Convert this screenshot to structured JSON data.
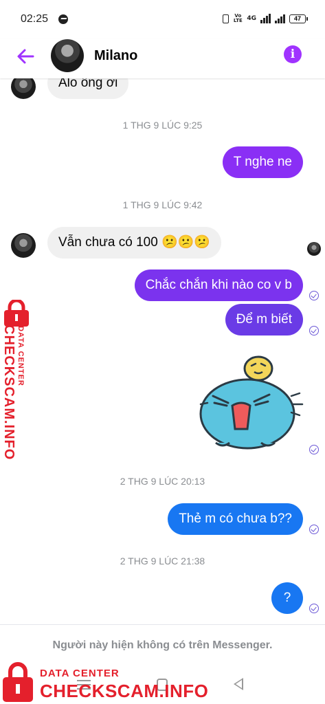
{
  "status_bar": {
    "time": "02:25",
    "volte": "Vo LTE",
    "network": "4G",
    "battery": "47"
  },
  "header": {
    "contact_name": "Milano",
    "info_icon": "i"
  },
  "messages": [
    {
      "from": "them",
      "text": "Alo ông ơi"
    },
    {
      "type": "timestamp",
      "text": "1 THG 9 LÚC 9:25"
    },
    {
      "from": "me",
      "text": "T nghe ne"
    },
    {
      "type": "timestamp",
      "text": "1 THG 9 LÚC 9:42"
    },
    {
      "from": "them",
      "text": "Vẫn chưa có 100 😕😕😕"
    },
    {
      "from": "me",
      "text": "Chắc chắn khi nào co v b"
    },
    {
      "from": "me",
      "text": "Để m biết"
    },
    {
      "from": "me",
      "type": "sticker",
      "sticker": "blue-creature-crying-sticker"
    },
    {
      "type": "timestamp",
      "text": "2 THG 9 LÚC 20:13"
    },
    {
      "from": "me",
      "text": "Thẻ m có chưa b??"
    },
    {
      "type": "timestamp",
      "text": "2 THG 9 LÚC 21:38"
    },
    {
      "from": "me",
      "text": "?"
    }
  ],
  "footer": {
    "notice": "Người này hiện không có trên Messenger."
  },
  "watermark": {
    "small": "DATA CENTER",
    "big": "CHECKSCAM.INFO"
  },
  "colors": {
    "accent": "#a033ff",
    "bubble_purple": "#8a2ff5",
    "bubble_violet": "#6a3be6",
    "bubble_blue": "#1877f2",
    "incoming_bubble": "#f0f0f0",
    "watermark_red": "#e4202c"
  }
}
